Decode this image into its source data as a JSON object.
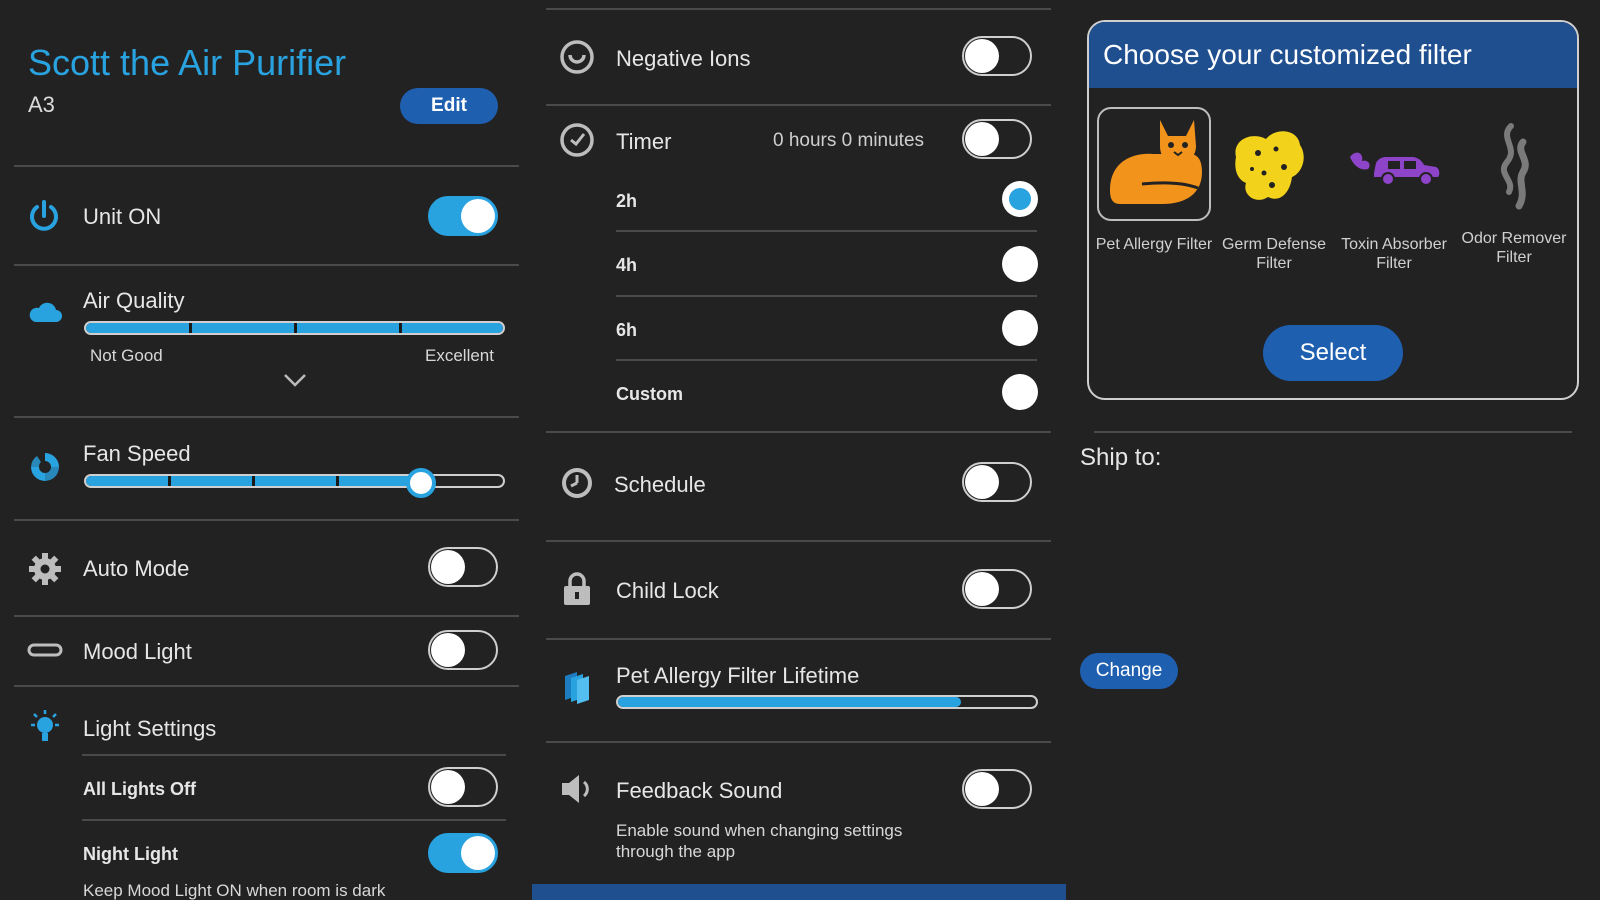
{
  "header": {
    "title": "Scott the Air Purifier",
    "model": "A3",
    "edit_label": "Edit"
  },
  "left": {
    "unit_on": {
      "label": "Unit ON",
      "on": true
    },
    "air_quality": {
      "label": "Air Quality",
      "low_label": "Not Good",
      "high_label": "Excellent",
      "level": 1.0
    },
    "fan_speed": {
      "label": "Fan Speed",
      "level": 0.8
    },
    "auto_mode": {
      "label": "Auto Mode",
      "on": false
    },
    "mood_light": {
      "label": "Mood Light",
      "on": false
    },
    "light_settings": {
      "label": "Light Settings",
      "all_lights_off": {
        "label": "All Lights Off",
        "on": false
      },
      "night_light": {
        "label": "Night Light",
        "on": true,
        "description": "Keep Mood Light ON when room is dark"
      }
    }
  },
  "middle": {
    "negative_ions": {
      "label": "Negative Ions",
      "on": false
    },
    "timer": {
      "label": "Timer",
      "value": "0 hours 0 minutes",
      "on": false,
      "options": [
        {
          "label": "2h",
          "selected": true
        },
        {
          "label": "4h",
          "selected": false
        },
        {
          "label": "6h",
          "selected": false
        },
        {
          "label": "Custom",
          "selected": false
        }
      ]
    },
    "schedule": {
      "label": "Schedule",
      "on": false
    },
    "child_lock": {
      "label": "Child Lock",
      "on": false
    },
    "filter_lifetime": {
      "label": "Pet Allergy Filter Lifetime",
      "level": 0.82
    },
    "feedback_sound": {
      "label": "Feedback Sound",
      "on": false,
      "description": "Enable sound when changing settings through the app"
    }
  },
  "right": {
    "filter_card": {
      "title": "Choose your customized filter",
      "filters": [
        {
          "name": "Pet Allergy Filter",
          "icon": "cat-icon",
          "color": "#f2941c",
          "selected": true
        },
        {
          "name": "Germ Defense Filter",
          "icon": "germ-sponge-icon",
          "color": "#f2d21a",
          "selected": false
        },
        {
          "name": "Toxin Absorber Filter",
          "icon": "car-exhaust-icon",
          "color": "#8e44c9",
          "selected": false
        },
        {
          "name": "Odor Remover Filter",
          "icon": "odor-smoke-icon",
          "color": "#7a7a7a",
          "selected": false
        }
      ],
      "select_label": "Select"
    },
    "ship_to_label": "Ship to:",
    "change_label": "Change"
  },
  "colors": {
    "accent": "#29a3e0",
    "button": "#1f5fb0",
    "background": "#232223"
  }
}
